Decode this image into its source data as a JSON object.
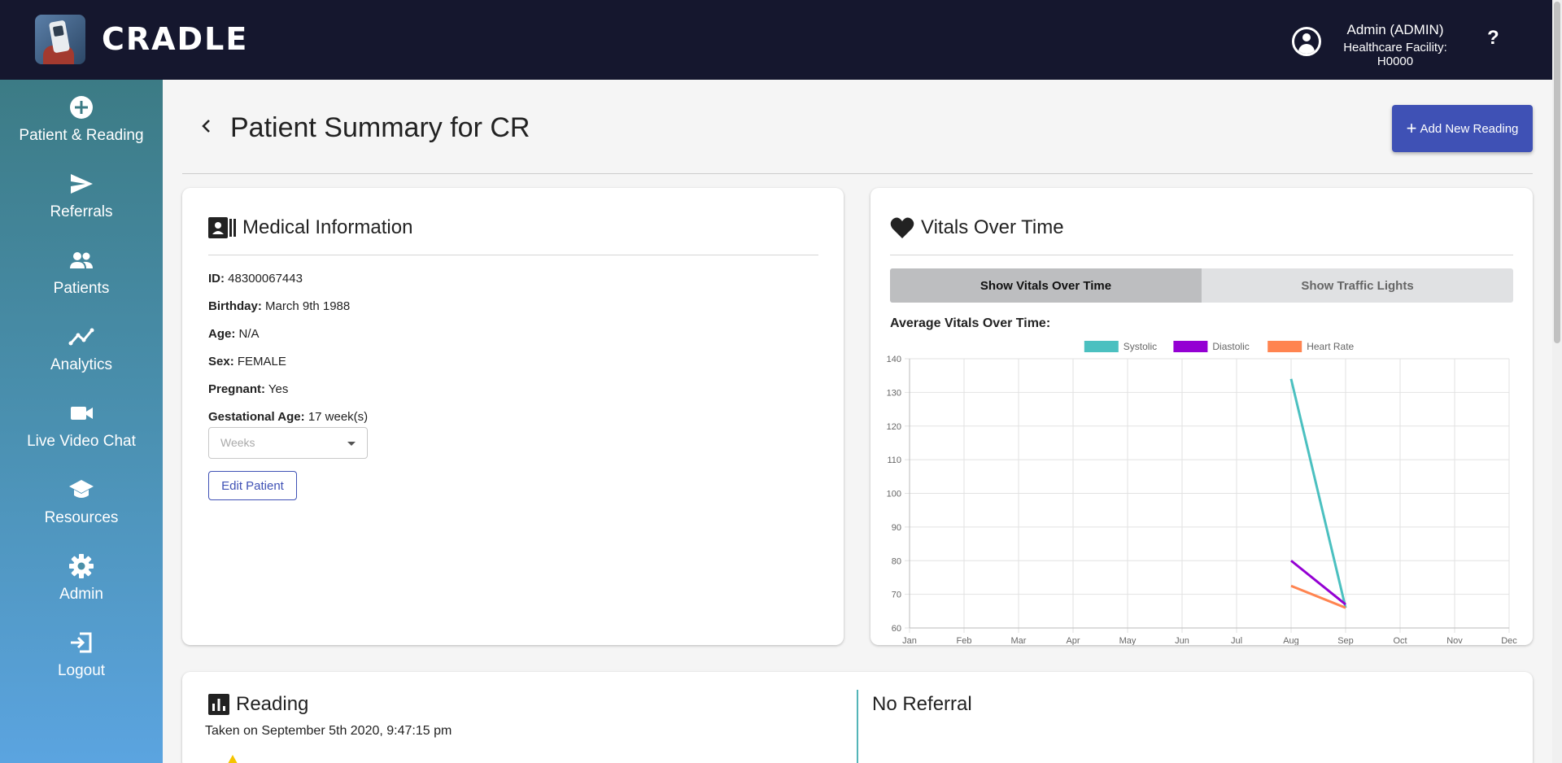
{
  "header": {
    "brand": "CRADLE",
    "user_name": "Admin (ADMIN)",
    "facility": "Healthcare Facility: H0000",
    "help": "?"
  },
  "sidebar": {
    "items": [
      {
        "label": "Patient & Reading",
        "icon": "add-circle-icon"
      },
      {
        "label": "Referrals",
        "icon": "send-icon"
      },
      {
        "label": "Patients",
        "icon": "people-icon"
      },
      {
        "label": "Analytics",
        "icon": "analytics-icon"
      },
      {
        "label": "Live Video Chat",
        "icon": "video-camera-icon"
      },
      {
        "label": "Resources",
        "icon": "school-icon"
      },
      {
        "label": "Admin",
        "icon": "gear-icon"
      },
      {
        "label": "Logout",
        "icon": "logout-icon"
      }
    ]
  },
  "page": {
    "title": "Patient Summary for CR",
    "add_button": "Add New Reading"
  },
  "medical": {
    "title": "Medical Information",
    "id_label": "ID:",
    "id_value": "48300067443",
    "birthday_label": "Birthday:",
    "birthday_value": "March 9th 1988",
    "age_label": "Age:",
    "age_value": "N/A",
    "sex_label": "Sex:",
    "sex_value": "FEMALE",
    "pregnant_label": "Pregnant:",
    "pregnant_value": "Yes",
    "gest_label": "Gestational Age:",
    "gest_value": "17 week(s)",
    "weeks_placeholder": "Weeks",
    "edit_button": "Edit Patient"
  },
  "vitals": {
    "title": "Vitals Over Time",
    "tab_active": "Show Vitals Over Time",
    "tab_inactive": "Show Traffic Lights",
    "chart_heading": "Average Vitals Over Time:"
  },
  "chart_data": {
    "type": "line",
    "categories": [
      "Jan",
      "Feb",
      "Mar",
      "Apr",
      "May",
      "Jun",
      "Jul",
      "Aug",
      "Sep",
      "Oct",
      "Nov",
      "Dec"
    ],
    "series": [
      {
        "name": "Systolic",
        "color": "#4bc0c0",
        "points": [
          [
            "Aug",
            134
          ],
          [
            "Sep",
            66
          ]
        ]
      },
      {
        "name": "Diastolic",
        "color": "#9400d3",
        "points": [
          [
            "Aug",
            80
          ],
          [
            "Sep",
            67
          ]
        ]
      },
      {
        "name": "Heart Rate",
        "color": "#ff8450",
        "points": [
          [
            "Aug",
            72.5
          ],
          [
            "Sep",
            66
          ]
        ]
      }
    ],
    "ylim": [
      60,
      140
    ],
    "yticks": [
      60,
      70,
      80,
      90,
      100,
      110,
      120,
      130,
      140
    ],
    "grid": true,
    "legend": "top-center"
  },
  "reading": {
    "title": "Reading",
    "taken": "Taken on September 5th 2020, 9:47:15 pm",
    "referral": "No Referral"
  }
}
